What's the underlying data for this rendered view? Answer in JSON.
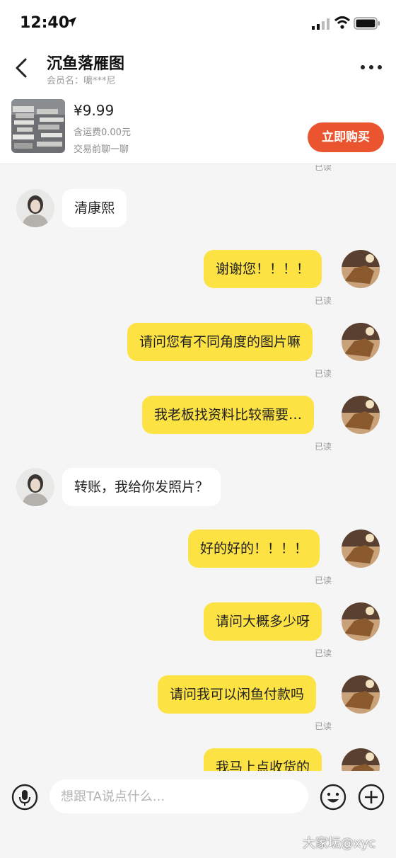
{
  "status_bar": {
    "time": "12:40"
  },
  "header": {
    "title": "沉鱼落雁图",
    "member": "会员名：嚰***尼"
  },
  "product": {
    "price": "¥9.99",
    "shipping": "含运费0.00元",
    "hint": "交易前聊一聊",
    "buy_label": "立即购买"
  },
  "chat": {
    "top_read": "已读",
    "messages": [
      {
        "side": "them",
        "text": "清康熙"
      },
      {
        "side": "me",
        "text": "谢谢您！！！！",
        "status": "已读"
      },
      {
        "side": "me",
        "text": "请问您有不同角度的图片嘛",
        "status": "已读"
      },
      {
        "side": "me",
        "text": "我老板找资料比较需要…",
        "status": "已读"
      },
      {
        "side": "them",
        "text": "转账，我给你发照片？"
      },
      {
        "side": "me",
        "text": "好的好的！！！！",
        "status": "已读"
      },
      {
        "side": "me",
        "text": "请问大概多少呀",
        "status": "已读"
      },
      {
        "side": "me",
        "text": "请问我可以闲鱼付款吗",
        "status": "已读"
      },
      {
        "side": "me",
        "text": "我马上点收货的"
      }
    ]
  },
  "input": {
    "placeholder": "想跟TA说点什么..."
  },
  "watermark": "大家坛@xyc",
  "colors": {
    "accent": "#ea5530",
    "my_bubble": "#fde244",
    "background": "#f5f5f5"
  }
}
